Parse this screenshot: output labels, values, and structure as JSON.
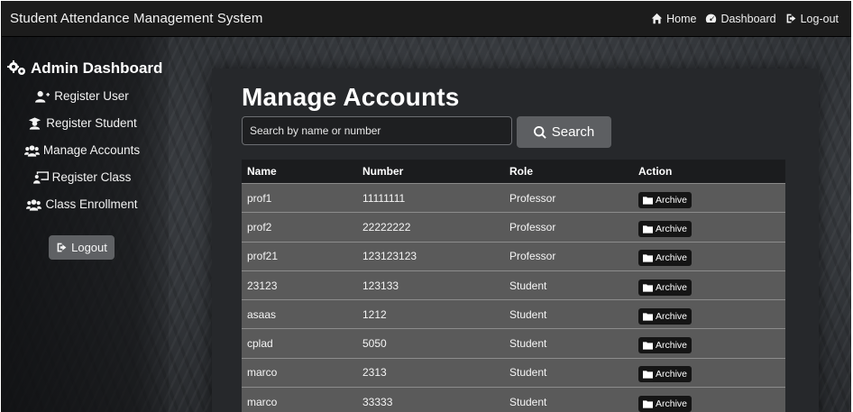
{
  "navbar": {
    "brand": "Student Attendance Management System",
    "links": [
      {
        "label": "Home",
        "icon": "home-icon"
      },
      {
        "label": "Dashboard",
        "icon": "dashboard-icon"
      },
      {
        "label": "Log-out",
        "icon": "logout-icon"
      }
    ]
  },
  "sidebar": {
    "title": "Admin Dashboard",
    "items": [
      {
        "label": "Register User",
        "icon": "user-plus-icon"
      },
      {
        "label": "Register Student",
        "icon": "graduate-icon"
      },
      {
        "label": "Manage Accounts",
        "icon": "users-icon"
      },
      {
        "label": "Register Class",
        "icon": "chalkboard-icon"
      },
      {
        "label": "Class Enrollment",
        "icon": "users-icon"
      }
    ],
    "logout_label": "Logout"
  },
  "main": {
    "title": "Manage Accounts",
    "search": {
      "placeholder": "Search by name or number",
      "button_label": "Search"
    },
    "table": {
      "columns": [
        "Name",
        "Number",
        "Role",
        "Action"
      ],
      "rows": [
        {
          "name": "prof1",
          "number": "11111111",
          "role": "Professor",
          "action": "Archive"
        },
        {
          "name": "prof2",
          "number": "22222222",
          "role": "Professor",
          "action": "Archive"
        },
        {
          "name": "prof21",
          "number": "123123123",
          "role": "Professor",
          "action": "Archive"
        },
        {
          "name": "23123",
          "number": "123133",
          "role": "Student",
          "action": "Archive"
        },
        {
          "name": "asaas",
          "number": "1212",
          "role": "Student",
          "action": "Archive"
        },
        {
          "name": "cplad",
          "number": "5050",
          "role": "Student",
          "action": "Archive"
        },
        {
          "name": "marco",
          "number": "2313",
          "role": "Student",
          "action": "Archive"
        },
        {
          "name": "marco",
          "number": "33333",
          "role": "Student",
          "action": "Archive"
        }
      ]
    }
  }
}
